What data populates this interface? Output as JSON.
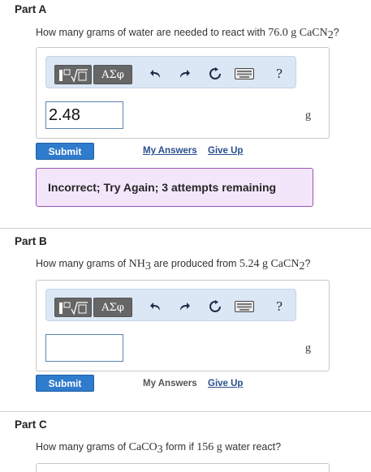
{
  "part_a": {
    "title": "Part A",
    "question_prefix": "How many grams of water are needed to react with ",
    "question_quantity": "76.0 g CaCN",
    "question_sub": "2",
    "question_suffix": "?",
    "answer_value": "2.48",
    "unit": "g",
    "submit_label": "Submit",
    "my_answers_label": "My Answers",
    "give_up_label": "Give Up",
    "feedback_text": "Incorrect; Try Again; 3 attempts remaining"
  },
  "part_b": {
    "title": "Part B",
    "question_prefix": "How many grams of ",
    "question_chem1": "NH",
    "question_chem1_sub": "3",
    "question_mid": " are produced from ",
    "question_quantity": "5.24 g CaCN",
    "question_sub": "2",
    "question_suffix": "?",
    "answer_value": "",
    "unit": "g",
    "submit_label": "Submit",
    "my_answers_label": "My Answers",
    "give_up_label": "Give Up"
  },
  "part_c": {
    "title": "Part C",
    "question_prefix": "How many grams of ",
    "question_chem1": "CaCO",
    "question_chem1_sub": "3",
    "question_mid": " form if ",
    "question_quantity": "156 g",
    "question_suffix": " water react?"
  },
  "toolbar": {
    "greek_label": "ΑΣφ",
    "help_label": "?",
    "icons": [
      "templates-icon",
      "greek-symbols-icon",
      "undo-icon",
      "redo-icon",
      "reset-icon",
      "keyboard-icon",
      "help-icon"
    ]
  },
  "colors": {
    "toolbar_bg": "#dbe7f5",
    "submit_bg": "#2f7bcc",
    "feedback_bg": "#f4e6fa",
    "feedback_border": "#9b55b8",
    "link": "#2a4e8c"
  }
}
